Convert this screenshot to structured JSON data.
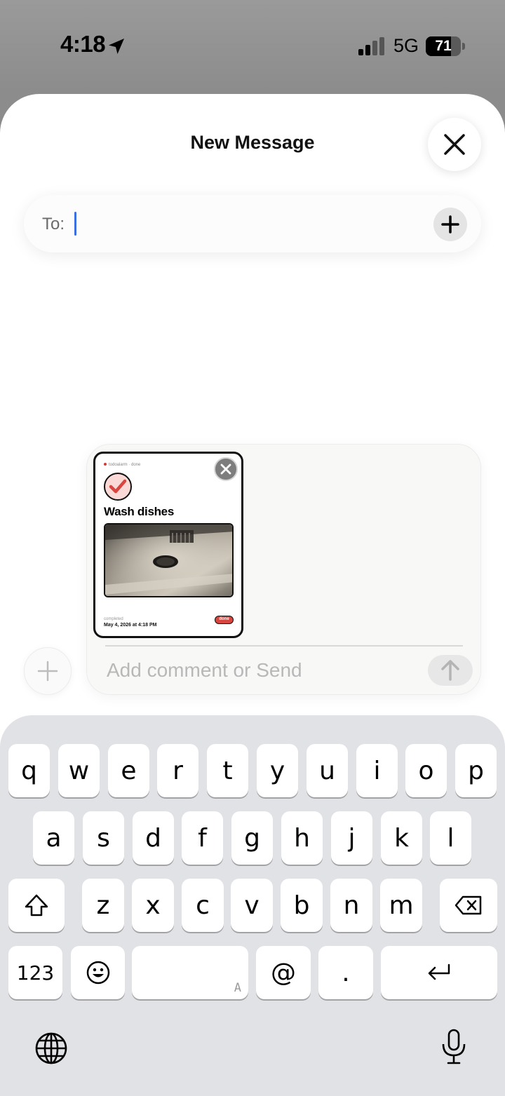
{
  "status_bar": {
    "time": "4:18",
    "network": "5G",
    "battery_percent": "71",
    "battery_level": 0.71,
    "icons": [
      "location-arrow-icon",
      "cellular-signal-icon",
      "battery-icon"
    ]
  },
  "header": {
    "title": "New Message",
    "close_icon": "close-icon"
  },
  "recipient": {
    "label": "To:",
    "value": "",
    "add_icon": "plus-icon"
  },
  "attachment": {
    "header": "todoalarm · done",
    "check_icon": "checkmark-icon",
    "title": "Wash dishes",
    "photo_description_icon": "photo-icon",
    "meta_label": "completed",
    "meta_date": "May 4, 2026 at 4:18 PM",
    "badge": "done",
    "remove_icon": "close-icon",
    "accent_color": "#d9453f"
  },
  "compose": {
    "placeholder": "Add comment or Send",
    "plus_icon": "plus-icon",
    "send_icon": "arrow-up-icon"
  },
  "keyboard": {
    "row1": [
      "q",
      "w",
      "e",
      "r",
      "t",
      "y",
      "u",
      "i",
      "o",
      "p"
    ],
    "row2": [
      "a",
      "s",
      "d",
      "f",
      "g",
      "h",
      "j",
      "k",
      "l"
    ],
    "row3": [
      "z",
      "x",
      "c",
      "v",
      "b",
      "n",
      "m"
    ],
    "numbers_key": "123",
    "at_key": "@",
    "period_key": ".",
    "space_hint": "A",
    "icons": [
      "shift-icon",
      "delete-icon",
      "emoji-icon",
      "return-icon",
      "globe-icon",
      "microphone-icon"
    ]
  }
}
